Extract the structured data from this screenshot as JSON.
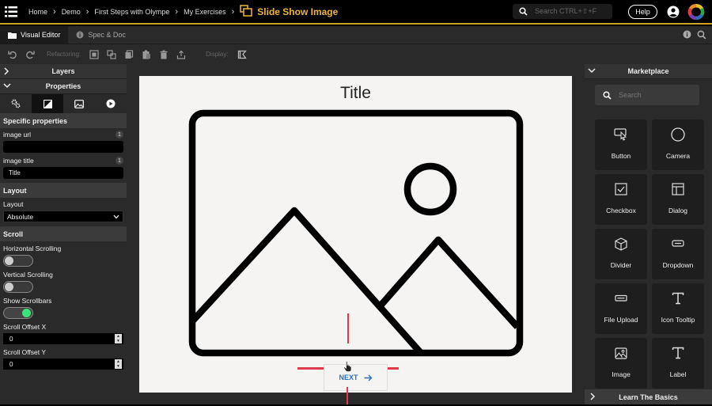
{
  "breadcrumb": {
    "items": [
      "Home",
      "Demo",
      "First Steps with Olympe",
      "My Exercises"
    ],
    "current": "Slide Show Image"
  },
  "search": {
    "placeholder": "Search CTRL+⇧+F"
  },
  "help": {
    "label": "Help"
  },
  "tabs": [
    {
      "label": "Visual Editor",
      "icon": "folder-icon"
    },
    {
      "label": "Spec & Doc",
      "icon": "info-icon"
    }
  ],
  "toolbar": {
    "refactoring_label": "Refactoring:",
    "display_label": "Display:"
  },
  "left_panel": {
    "layers_label": "Layers",
    "properties_label": "Properties",
    "specific_properties": "Specific properties",
    "image_url": {
      "label": "image url",
      "value": "",
      "badge": "1"
    },
    "image_title": {
      "label": "image title",
      "value": "Title",
      "badge": "1"
    },
    "layout_section": "Layout",
    "layout": {
      "label": "Layout",
      "value": "Absolute"
    },
    "scroll_section": "Scroll",
    "horizontal_scrolling": {
      "label": "Horizontal Scrolling",
      "on": false
    },
    "vertical_scrolling": {
      "label": "Vertical Scrolling",
      "on": false
    },
    "show_scrollbars": {
      "label": "Show Scrollbars",
      "on": true
    },
    "scroll_offset_x": {
      "label": "Scroll Offset X",
      "value": "0"
    },
    "scroll_offset_y": {
      "label": "Scroll Offset Y",
      "value": "0"
    }
  },
  "canvas": {
    "title": "Title",
    "next_label": "NEXT",
    "marker_color": "#e03a4e"
  },
  "marketplace": {
    "header": "Marketplace",
    "search_placeholder": "Search",
    "items": [
      {
        "label": "Button",
        "icon": "cursor-icon"
      },
      {
        "label": "Camera",
        "icon": "circle-icon"
      },
      {
        "label": "Checkbox",
        "icon": "checkbox-icon"
      },
      {
        "label": "Dialog",
        "icon": "dialog-icon"
      },
      {
        "label": "Divider",
        "icon": "cube-icon"
      },
      {
        "label": "Dropdown",
        "icon": "dropdown-icon"
      },
      {
        "label": "File Upload",
        "icon": "file-upload-icon"
      },
      {
        "label": "Icon Tooltip",
        "icon": "text-t-icon"
      },
      {
        "label": "Image",
        "icon": "image-icon"
      },
      {
        "label": "Label",
        "icon": "text-t-icon"
      }
    ],
    "learn_label": "Learn The Basics"
  },
  "colors": {
    "accent": "#f0b53a",
    "toggle_on": "#3ee27a",
    "link_blue": "#2b6fb5"
  }
}
